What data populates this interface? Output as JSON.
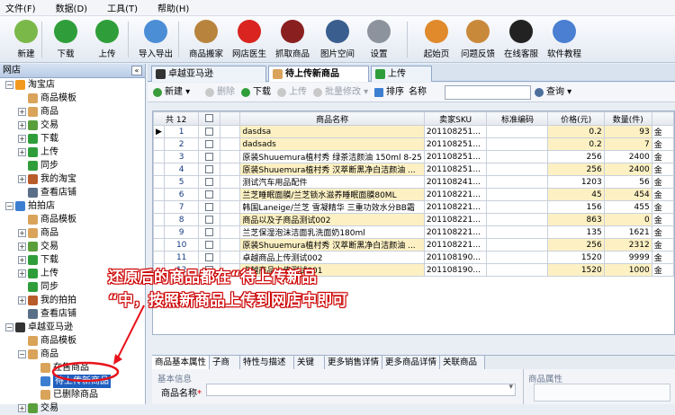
{
  "menu": [
    "文件(F)",
    "数据(D)",
    "工具(T)",
    "帮助(H)"
  ],
  "toolbar": [
    {
      "label": "新建",
      "icon": "new-doc-icon",
      "color": "#7bb84a"
    },
    {
      "label": "下载",
      "icon": "download-icon",
      "color": "#2f9e3a"
    },
    {
      "label": "上传",
      "icon": "upload-icon",
      "color": "#2f9e3a"
    },
    {
      "label": "导入导出",
      "icon": "import-export-icon",
      "color": "#4c8ed6"
    },
    {
      "label": "商品搬家",
      "icon": "move-goods-icon",
      "color": "#b8843d"
    },
    {
      "label": "网店医生",
      "icon": "red-cross-icon",
      "color": "#d9241f"
    },
    {
      "label": "抓取商品",
      "icon": "spider-icon",
      "color": "#8a1f1f"
    },
    {
      "label": "图片空间",
      "icon": "picture-icon",
      "color": "#3a5f8f"
    },
    {
      "label": "设置",
      "icon": "gear-icon",
      "color": "#8c939c"
    },
    {
      "label": "起始页",
      "icon": "home-icon",
      "color": "#e08a2c"
    },
    {
      "label": "问题反馈",
      "icon": "feedback-icon",
      "color": "#c9893b"
    },
    {
      "label": "在线客服",
      "icon": "qq-penguin-icon",
      "color": "#222222"
    },
    {
      "label": "软件教程",
      "icon": "help-icon",
      "color": "#4a7fd1"
    }
  ],
  "left_panel": {
    "title": "网店",
    "close": "«",
    "tree": [
      {
        "text": "淘宝店",
        "level": 0,
        "exp": "−",
        "icon": "shop-icon",
        "color": "#f29a1f"
      },
      {
        "text": "商品模板",
        "level": 1,
        "exp": "",
        "icon": "template-icon",
        "color": "#d9a35a"
      },
      {
        "text": "商品",
        "level": 1,
        "exp": "+",
        "icon": "goods-icon",
        "color": "#d9a35a"
      },
      {
        "text": "交易",
        "level": 1,
        "exp": "+",
        "icon": "trade-icon",
        "color": "#5a9e3c"
      },
      {
        "text": "下载",
        "level": 1,
        "exp": "+",
        "icon": "download-icon",
        "color": "#2f9e3a"
      },
      {
        "text": "上传",
        "level": 1,
        "exp": "+",
        "icon": "upload-icon",
        "color": "#2f9e3a"
      },
      {
        "text": "同步",
        "level": 1,
        "exp": "",
        "icon": "sync-icon",
        "color": "#2f9e3a"
      },
      {
        "text": "我的淘宝",
        "level": 1,
        "exp": "+",
        "icon": "user-icon",
        "color": "#b85c2c"
      },
      {
        "text": "查看店铺",
        "level": 1,
        "exp": "",
        "icon": "store-view-icon",
        "color": "#5a6e88"
      },
      {
        "text": "拍拍店",
        "level": 0,
        "exp": "−",
        "icon": "shop-icon",
        "color": "#3c7fd1"
      },
      {
        "text": "商品模板",
        "level": 1,
        "exp": "",
        "icon": "template-icon",
        "color": "#d9a35a"
      },
      {
        "text": "商品",
        "level": 1,
        "exp": "+",
        "icon": "goods-icon",
        "color": "#d9a35a"
      },
      {
        "text": "交易",
        "level": 1,
        "exp": "+",
        "icon": "trade-icon",
        "color": "#5a9e3c"
      },
      {
        "text": "下载",
        "level": 1,
        "exp": "+",
        "icon": "download-icon",
        "color": "#2f9e3a"
      },
      {
        "text": "上传",
        "level": 1,
        "exp": "+",
        "icon": "upload-icon",
        "color": "#2f9e3a"
      },
      {
        "text": "同步",
        "level": 1,
        "exp": "",
        "icon": "sync-icon",
        "color": "#2f9e3a"
      },
      {
        "text": "我的拍拍",
        "level": 1,
        "exp": "+",
        "icon": "user-icon",
        "color": "#b85c2c"
      },
      {
        "text": "查看店铺",
        "level": 1,
        "exp": "",
        "icon": "store-view-icon",
        "color": "#5a6e88"
      },
      {
        "text": "卓越亚马逊",
        "level": 0,
        "exp": "−",
        "icon": "shop-icon",
        "color": "#333333"
      },
      {
        "text": "商品模板",
        "level": 1,
        "exp": "",
        "icon": "template-icon",
        "color": "#d9a35a"
      },
      {
        "text": "商品",
        "level": 1,
        "exp": "−",
        "icon": "goods-icon",
        "color": "#d9a35a"
      },
      {
        "text": "在售商品",
        "level": 2,
        "exp": "",
        "icon": "onsale-icon",
        "color": "#d9a35a"
      },
      {
        "text": "待上传新商品",
        "level": 2,
        "exp": "",
        "icon": "pending-upload-icon",
        "color": "#3c7fd1",
        "selected": true
      },
      {
        "text": "已删除商品",
        "level": 2,
        "exp": "",
        "icon": "deleted-icon",
        "color": "#d9a35a"
      },
      {
        "text": "交易",
        "level": 1,
        "exp": "+",
        "icon": "trade-icon",
        "color": "#5a9e3c"
      }
    ]
  },
  "tabs": [
    {
      "label": "卓越亚马逊",
      "icon": "amazon-icon",
      "color": "#333333"
    },
    {
      "label": "待上传新商品",
      "icon": "goods-icon",
      "color": "#d9a35a",
      "active": true
    },
    {
      "label": "上传",
      "icon": "upload-icon",
      "color": "#2f9e3a"
    }
  ],
  "subtoolbar": {
    "new": "新建",
    "delete": "删除",
    "download": "下载",
    "upload": "上传",
    "batch": "批量修改",
    "sort": "排序",
    "name_label": "名称",
    "name_value": "",
    "query": "查询"
  },
  "grid": {
    "total": "共 12",
    "headers": [
      "商品名称",
      "卖家SKU",
      "标准编码",
      "价格(元)",
      "数量(件)"
    ],
    "rows": [
      {
        "no": "1",
        "name": "dasdsa",
        "sku": "201108251...",
        "code": "",
        "price": "0.2",
        "qty": "93",
        "yellow": true,
        "current": true
      },
      {
        "no": "2",
        "name": "dadsads",
        "sku": "201108251...",
        "code": "",
        "price": "0.2",
        "qty": "7",
        "yellow": true
      },
      {
        "no": "3",
        "name": "原装Shuuemura植村秀 绿茶洁颜油 150ml 8-25",
        "sku": "201108251...",
        "code": "",
        "price": "256",
        "qty": "2400",
        "yellow": false
      },
      {
        "no": "4",
        "name": "原装Shuuemura植村秀 汉萃断黑净白洁颜油 ...",
        "sku": "201108251...",
        "code": "",
        "price": "256",
        "qty": "2400",
        "yellow": true
      },
      {
        "no": "5",
        "name": "测试汽车用品配件",
        "sku": "201108241...",
        "code": "",
        "price": "1203",
        "qty": "56",
        "yellow": false
      },
      {
        "no": "6",
        "name": "兰芝睡眠面膜/兰芝锁水滋养睡眠面膜80ML",
        "sku": "201108221...",
        "code": "",
        "price": "45",
        "qty": "454",
        "yellow": true
      },
      {
        "no": "7",
        "name": "韩国Laneige/兰芝 雪凝精华 三重功效水分BB霜",
        "sku": "201108221...",
        "code": "",
        "price": "156",
        "qty": "455",
        "yellow": false
      },
      {
        "no": "8",
        "name": "商品以及子商品测试002",
        "sku": "201108221...",
        "code": "",
        "price": "863",
        "qty": "0",
        "yellow": true
      },
      {
        "no": "9",
        "name": "兰芝保湿泡沫洁面乳洗面奶180ml",
        "sku": "201108221...",
        "code": "",
        "price": "135",
        "qty": "1621",
        "yellow": false
      },
      {
        "no": "10",
        "name": "原装Shuuemura植村秀 汉萃断黑净白洁颜油 ...",
        "sku": "201108221...",
        "code": "",
        "price": "256",
        "qty": "2312",
        "yellow": true
      },
      {
        "no": "11",
        "name": "卓越商品上传测试002",
        "sku": "201108190...",
        "code": "",
        "price": "1520",
        "qty": "9999",
        "yellow": false
      },
      {
        "no": "12",
        "name": "卓越商品上传测试001",
        "sku": "201108190...",
        "code": "",
        "price": "1520",
        "qty": "1000",
        "yellow": true
      }
    ]
  },
  "bottom_tabs": [
    "商品基本属性",
    "子商品",
    "特性与描述",
    "关键字",
    "更多销售详情",
    "更多商品详情",
    "关联商品"
  ],
  "detail": {
    "basic_info": "基本信息",
    "goods_name_label": "商品名称",
    "goods_props": "商品属性"
  },
  "annotation": {
    "line1": "还原后的商品都在“待上传新品",
    "line2": "“中，按照新商品上传到网店中即可"
  }
}
